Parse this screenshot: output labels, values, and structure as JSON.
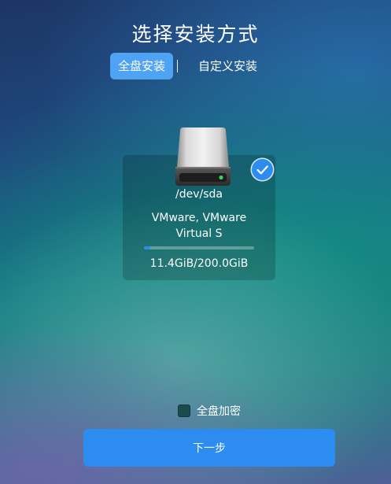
{
  "title": "选择安装方式",
  "tabs": [
    {
      "label": "全盘安装",
      "active": true
    },
    {
      "label": "自定义安装",
      "active": false
    }
  ],
  "disk": {
    "path": "/dev/sda",
    "model_line1": "VMware, VMware",
    "model_line2": "Virtual S",
    "size_text": "11.4GiB/200.0GiB",
    "used_fraction": 0.057,
    "selected": true,
    "icon": "hard-drive-icon",
    "led_color": "#39d353"
  },
  "encrypt": {
    "label": "全盘加密",
    "checked": false
  },
  "next_button": {
    "label": "下一步"
  },
  "colors": {
    "accent": "#2d8cf0",
    "active_tab": "#4ea3f3"
  }
}
